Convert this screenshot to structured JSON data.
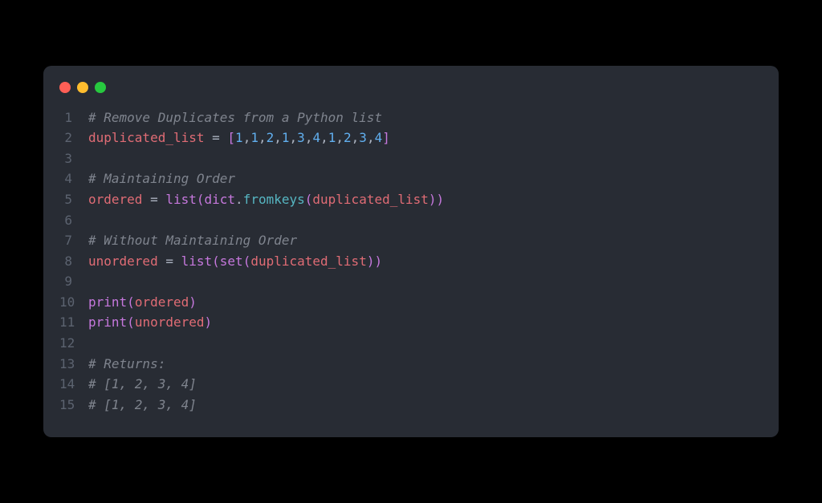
{
  "window_controls": {
    "close": "close",
    "minimize": "minimize",
    "maximize": "maximize"
  },
  "lines": {
    "1": {
      "num": "1"
    },
    "2": {
      "num": "2"
    },
    "3": {
      "num": "3"
    },
    "4": {
      "num": "4"
    },
    "5": {
      "num": "5"
    },
    "6": {
      "num": "6"
    },
    "7": {
      "num": "7"
    },
    "8": {
      "num": "8"
    },
    "9": {
      "num": "9"
    },
    "10": {
      "num": "10"
    },
    "11": {
      "num": "11"
    },
    "12": {
      "num": "12"
    },
    "13": {
      "num": "13"
    },
    "14": {
      "num": "14"
    },
    "15": {
      "num": "15"
    }
  },
  "tokens": {
    "l1_comment": "# Remove Duplicates from a Python list",
    "l2_var": "duplicated_list",
    "l2_sp_eq_sp": " = ",
    "l2_lb": "[",
    "l2_n1a": "1",
    "l2_c1": ",",
    "l2_n1b": "1",
    "l2_c2": ",",
    "l2_n2a": "2",
    "l2_c3": ",",
    "l2_n1c": "1",
    "l2_c4": ",",
    "l2_n3a": "3",
    "l2_c5": ",",
    "l2_n4a": "4",
    "l2_c6": ",",
    "l2_n1d": "1",
    "l2_c7": ",",
    "l2_n2b": "2",
    "l2_c8": ",",
    "l2_n3b": "3",
    "l2_c9": ",",
    "l2_n4b": "4",
    "l2_rb": "]",
    "l4_comment": "# Maintaining Order",
    "l5_var": "ordered",
    "l5_sp_eq_sp": " = ",
    "l5_list": "list",
    "l5_lp1": "(",
    "l5_dict": "dict",
    "l5_dot": ".",
    "l5_fromkeys": "fromkeys",
    "l5_lp2": "(",
    "l5_arg": "duplicated_list",
    "l5_rp2": ")",
    "l5_rp1": ")",
    "l7_comment": "# Without Maintaining Order",
    "l8_var": "unordered",
    "l8_sp_eq_sp": " = ",
    "l8_list": "list",
    "l8_lp1": "(",
    "l8_set": "set",
    "l8_lp2": "(",
    "l8_arg": "duplicated_list",
    "l8_rp2": ")",
    "l8_rp1": ")",
    "l10_print": "print",
    "l10_lp": "(",
    "l10_arg": "ordered",
    "l10_rp": ")",
    "l11_print": "print",
    "l11_lp": "(",
    "l11_arg": "unordered",
    "l11_rp": ")",
    "l13_comment": "# Returns:",
    "l14_comment": "# [1, 2, 3, 4]",
    "l15_comment": "# [1, 2, 3, 4]"
  }
}
